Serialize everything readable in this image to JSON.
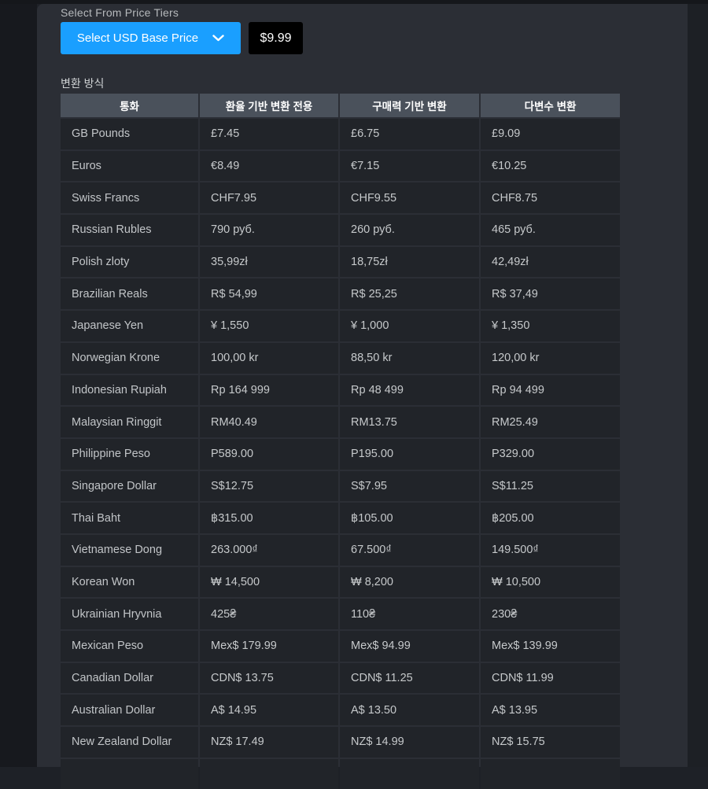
{
  "price_tiers": {
    "label": "Select From Price Tiers",
    "dropdown_label": "Select USD Base Price",
    "base_price": "$9.99"
  },
  "conversion": {
    "section_label": "변환 방식",
    "table": {
      "headers": [
        "통화",
        "환율 기반 변환 전용",
        "구매력 기반 변환",
        "다변수 변환"
      ],
      "rows": [
        [
          "GB Pounds",
          "£7.45",
          "£6.75",
          "£9.09"
        ],
        [
          "Euros",
          "€8.49",
          "€7.15",
          "€10.25"
        ],
        [
          "Swiss Francs",
          "CHF7.95",
          "CHF9.55",
          "CHF8.75"
        ],
        [
          "Russian Rubles",
          "790 руб.",
          "260 руб.",
          "465 руб."
        ],
        [
          "Polish zloty",
          "35,99zł",
          "18,75zł",
          "42,49zł"
        ],
        [
          "Brazilian Reals",
          "R$ 54,99",
          "R$ 25,25",
          "R$ 37,49"
        ],
        [
          "Japanese Yen",
          "¥ 1,550",
          "¥ 1,000",
          "¥ 1,350"
        ],
        [
          "Norwegian Krone",
          "100,00 kr",
          "88,50 kr",
          "120,00 kr"
        ],
        [
          "Indonesian Rupiah",
          "Rp 164 999",
          "Rp 48 499",
          "Rp 94 499"
        ],
        [
          "Malaysian Ringgit",
          "RM40.49",
          "RM13.75",
          "RM25.49"
        ],
        [
          "Philippine Peso",
          "P589.00",
          "P195.00",
          "P329.00"
        ],
        [
          "Singapore Dollar",
          "S$12.75",
          "S$7.95",
          "S$11.25"
        ],
        [
          "Thai Baht",
          "฿315.00",
          "฿105.00",
          "฿205.00"
        ],
        [
          "Vietnamese Dong",
          "263.000₫",
          "67.500₫",
          "149.500₫"
        ],
        [
          "Korean Won",
          "₩ 14,500",
          "₩ 8,200",
          "₩ 10,500"
        ],
        [
          "Ukrainian Hryvnia",
          "425₴",
          "110₴",
          "230₴"
        ],
        [
          "Mexican Peso",
          "Mex$ 179.99",
          "Mex$ 94.99",
          "Mex$ 139.99"
        ],
        [
          "Canadian Dollar",
          "CDN$ 13.75",
          "CDN$ 11.25",
          "CDN$ 11.99"
        ],
        [
          "Australian Dollar",
          "A$ 14.95",
          "A$ 13.50",
          "A$ 13.95"
        ],
        [
          "New Zealand Dollar",
          "NZ$ 17.49",
          "NZ$ 14.99",
          "NZ$ 15.75"
        ]
      ]
    }
  },
  "colors": {
    "accent_blue": "#1a9fff",
    "price_box_bg": "#000000",
    "table_header_bg": "#4a515b",
    "row_bg": "#212429",
    "panel_bg": "#2b2e35"
  }
}
